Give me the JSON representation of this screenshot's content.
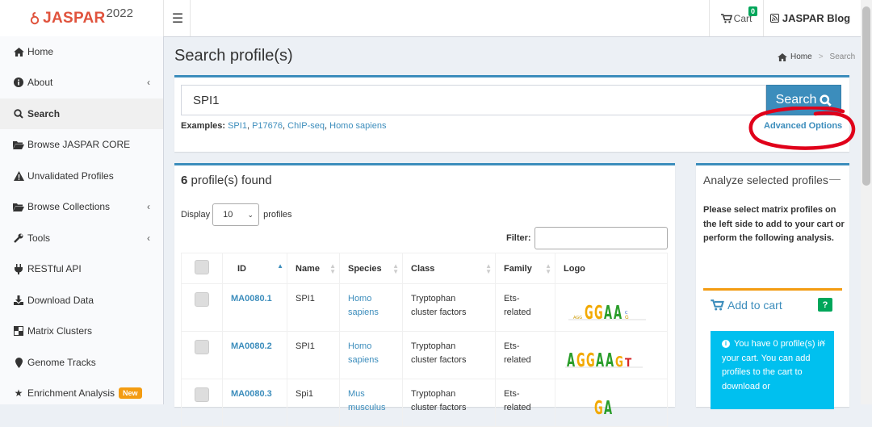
{
  "brand": {
    "name": "JASPAR",
    "year": "2022",
    "color": "#e0533d"
  },
  "topnav": {
    "cart_label": "Cart",
    "cart_count": "0",
    "blog_label": "JASPAR Blog"
  },
  "sidebar": {
    "items": [
      {
        "label": "Home",
        "icon": "home-icon"
      },
      {
        "label": "About",
        "icon": "info-circle-icon",
        "has_children": true
      },
      {
        "label": "Search",
        "icon": "search-icon",
        "active": true
      },
      {
        "label": "Browse JASPAR CORE",
        "icon": "folder-open-icon"
      },
      {
        "label": "Unvalidated Profiles",
        "icon": "warning-icon"
      },
      {
        "label": "Browse Collections",
        "icon": "folder-open-icon",
        "has_children": true
      },
      {
        "label": "Tools",
        "icon": "wrench-icon",
        "has_children": true
      },
      {
        "label": "RESTful API",
        "icon": "plug-icon"
      },
      {
        "label": "Download Data",
        "icon": "download-icon"
      },
      {
        "label": "Matrix Clusters",
        "icon": "clusters-icon"
      },
      {
        "label": "Genome Tracks",
        "icon": "map-marker-icon"
      },
      {
        "label": "Enrichment Analysis",
        "icon": "star-icon",
        "badge": "New"
      }
    ]
  },
  "page": {
    "title": "Search profile(s)",
    "breadcrumb": {
      "home": "Home",
      "current": "Search"
    }
  },
  "search": {
    "value": "SPI1",
    "button": "Search",
    "examples_label": "Examples:",
    "examples": [
      "SPI1",
      "P17676",
      "ChIP-seq",
      "Homo sapiens"
    ],
    "advanced": "Advanced Options"
  },
  "results": {
    "count": "6",
    "found_label": "profile(s) found",
    "display_label": "Display",
    "display_value": "10",
    "profiles_label": "profiles",
    "filter_label": "Filter:",
    "columns": [
      "ID",
      "Name",
      "Species",
      "Class",
      "Family",
      "Logo"
    ],
    "rows": [
      {
        "id": "MA0080.1",
        "name": "SPI1",
        "species": [
          "Homo",
          "sapiens"
        ],
        "class": [
          "Tryptophan",
          "cluster factors"
        ],
        "family": [
          "Ets-",
          "related"
        ],
        "logo": "GGAA"
      },
      {
        "id": "MA0080.2",
        "name": "SPI1",
        "species": [
          "Homo",
          "sapiens"
        ],
        "class": [
          "Tryptophan",
          "cluster factors"
        ],
        "family": [
          "Ets-",
          "related"
        ],
        "logo": "AGGAAGT"
      },
      {
        "id": "MA0080.3",
        "name": "Spi1",
        "species": [
          "Mus",
          "musculus"
        ],
        "class": [
          "Tryptophan",
          "cluster factors"
        ],
        "family": [
          "Ets-",
          "related"
        ],
        "logo": "GGAA"
      }
    ]
  },
  "analyze": {
    "title": "Analyze selected profiles",
    "text": "Please select matrix profiles on the left side to add to your cart or perform the following analysis.",
    "add_to_cart": "Add to cart",
    "help": "?",
    "info_text": "You have 0 profile(s) in your cart. You can add profiles to the cart to download or"
  },
  "colors": {
    "primary": "#3c8dbc",
    "success": "#00a65a",
    "warning": "#f39c12",
    "info": "#00c0ef",
    "annotation_red": "#e0001a"
  }
}
